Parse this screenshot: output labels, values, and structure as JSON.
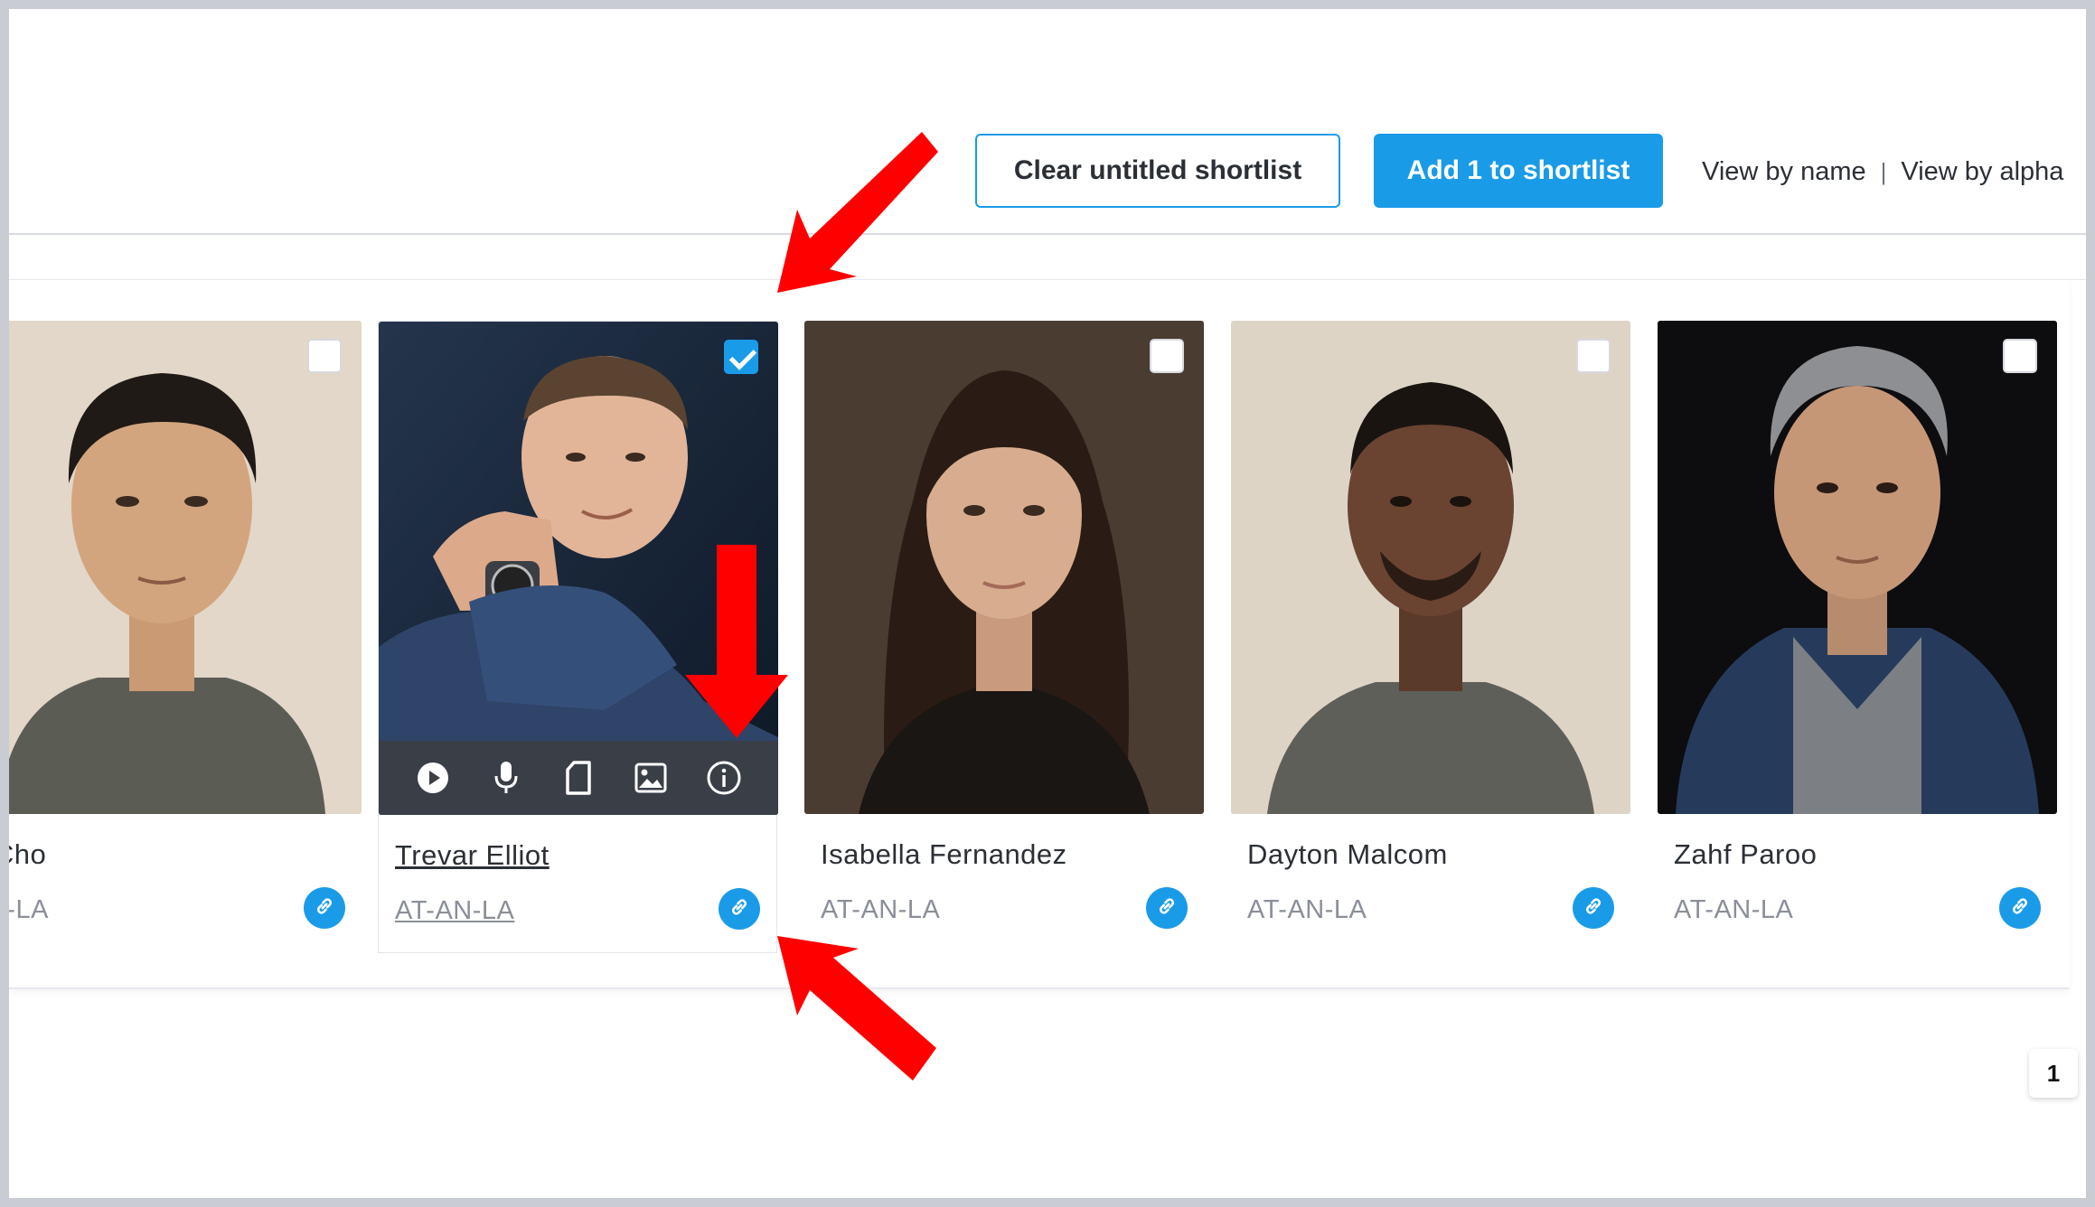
{
  "toolbar": {
    "clear_label": "Clear untitled shortlist",
    "add_label": "Add 1 to shortlist",
    "view_by_name": "View by name",
    "separator": "|",
    "view_by_alpha": "View by alpha"
  },
  "cards": [
    {
      "name": "e Cho",
      "code": "AN-LA",
      "selected": false
    },
    {
      "name": "Trevar Elliot",
      "code": "AT-AN-LA",
      "selected": true
    },
    {
      "name": "Isabella Fernandez",
      "code": "AT-AN-LA",
      "selected": false
    },
    {
      "name": "Dayton Malcom",
      "code": "AT-AN-LA",
      "selected": false
    },
    {
      "name": "Zahf Paroo",
      "code": "AT-AN-LA",
      "selected": false
    }
  ],
  "media_icons": [
    "play-icon",
    "microphone-icon",
    "document-icon",
    "image-icon",
    "info-icon"
  ],
  "pagination": {
    "current": "1"
  },
  "colors": {
    "accent": "#1a9be8",
    "annotation_arrow": "#ff0000"
  }
}
